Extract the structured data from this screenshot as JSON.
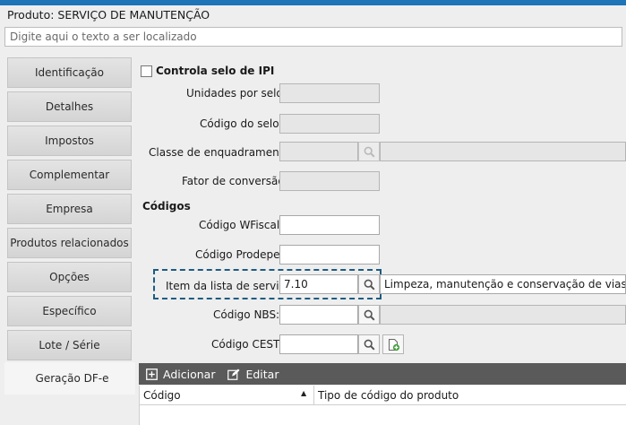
{
  "window": {
    "title": "Produto: SERVIÇO DE MANUTENÇÃO",
    "accent_color": "#1f73b7"
  },
  "search": {
    "placeholder": "Digite aqui o texto a ser localizado",
    "value": ""
  },
  "sidebar": {
    "active_index": 10,
    "items": [
      {
        "label": "Identificação"
      },
      {
        "label": "Detalhes"
      },
      {
        "label": "Impostos"
      },
      {
        "label": "Complementar"
      },
      {
        "label": "Empresa"
      },
      {
        "label": "Produtos relacionados"
      },
      {
        "label": "Opções"
      },
      {
        "label": "Específico"
      },
      {
        "label": "Lote / Série"
      },
      {
        "label": "Geração DF-e"
      }
    ]
  },
  "ipi": {
    "checkbox_label": "Controla selo de IPI",
    "checked": false,
    "unidades_label": "Unidades por selo:",
    "codigo_selo_label": "Código do selo:",
    "classe_label": "Classe de enquadramento:",
    "fator_label": "Fator de conversão:"
  },
  "codigos": {
    "section_title": "Códigos",
    "wfiscal_label": "Código WFiscal:",
    "wfiscal_value": "",
    "prodepe_label": "Código Prodepe:",
    "prodepe_value": "",
    "item_lista_label": "Item da lista de serviço:",
    "item_lista_value": "7.10",
    "item_lista_desc": "Limpeza, manutenção e conservação de vias e logradouros",
    "nbs_label": "Código NBS:",
    "nbs_value": "",
    "cest_label": "Código CEST:",
    "cest_value": ""
  },
  "grid": {
    "add_label": "Adicionar",
    "edit_label": "Editar",
    "columns": [
      "Código",
      "Tipo de código do produto"
    ],
    "rows": []
  },
  "icons": {
    "lookup": "search-icon",
    "add": "plus-square-icon",
    "edit": "pencil-icon",
    "new": "add-document-icon",
    "sort": "sort-ascending-icon"
  }
}
